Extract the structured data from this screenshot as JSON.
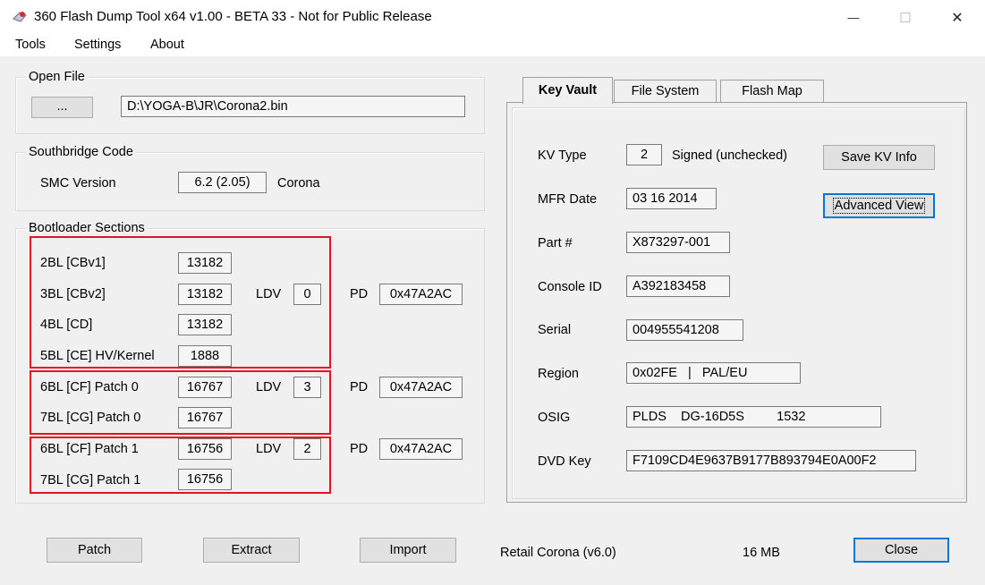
{
  "window": {
    "title": "360 Flash Dump Tool x64 v1.00 - BETA 33 - Not for Public Release",
    "minimize_glyph": "—",
    "maximize_glyph": "☐",
    "close_glyph": "✕"
  },
  "menu": {
    "tools": "Tools",
    "settings": "Settings",
    "about": "About"
  },
  "open_file": {
    "label": "Open File",
    "browse": "...",
    "path": "D:\\YOGA-B\\JR\\Corona2.bin"
  },
  "southbridge": {
    "label": "Southbridge Code",
    "smc_label": "SMC Version",
    "smc_value": "6.2 (2.05)",
    "board": "Corona"
  },
  "bootloader": {
    "label": "Bootloader Sections",
    "rows": [
      {
        "name": "2BL [CBv1]",
        "value": "13182"
      },
      {
        "name": "3BL [CBv2]",
        "value": "13182",
        "ldv_label": "LDV",
        "ldv": "0",
        "pd_label": "PD",
        "pd": "0x47A2AC"
      },
      {
        "name": "4BL [CD]",
        "value": "13182"
      },
      {
        "name": "5BL [CE] HV/Kernel",
        "value": "1888"
      },
      {
        "name": "6BL [CF] Patch 0",
        "value": "16767",
        "ldv_label": "LDV",
        "ldv": "3",
        "pd_label": "PD",
        "pd": "0x47A2AC"
      },
      {
        "name": "7BL [CG] Patch 0",
        "value": "16767"
      },
      {
        "name": "6BL [CF] Patch 1",
        "value": "16756",
        "ldv_label": "LDV",
        "ldv": "2",
        "pd_label": "PD",
        "pd": "0x47A2AC"
      },
      {
        "name": "7BL [CG] Patch 1",
        "value": "16756"
      }
    ]
  },
  "tabs": {
    "key_vault": "Key Vault",
    "file_system": "File System",
    "flash_map": "Flash Map"
  },
  "keyvault": {
    "kv_type_label": "KV Type",
    "kv_type": "2",
    "signed": "Signed (unchecked)",
    "save_kv": "Save KV Info",
    "advanced_view": "Advanced View",
    "mfr_label": "MFR Date",
    "mfr": "03 16 2014",
    "part_label": "Part #",
    "part": "X873297-001",
    "console_id_label": "Console ID",
    "console_id": "A392183458",
    "serial_label": "Serial",
    "serial": "004955541208",
    "region_label": "Region",
    "region": "0x02FE   |   PAL/EU",
    "osig_label": "OSIG",
    "osig": "PLDS    DG-16D5S         1532",
    "dvd_label": "DVD Key",
    "dvd": "F7109CD4E9637B9177B893794E0A00F2"
  },
  "footer": {
    "patch": "Patch",
    "extract": "Extract",
    "import": "Import",
    "status": "Retail Corona (v6.0)",
    "size": "16 MB",
    "close": "Close"
  },
  "colors": {
    "highlight_border": "#e81123",
    "focus_border": "#0078d7",
    "dialog_bg": "#f0f0f0"
  }
}
